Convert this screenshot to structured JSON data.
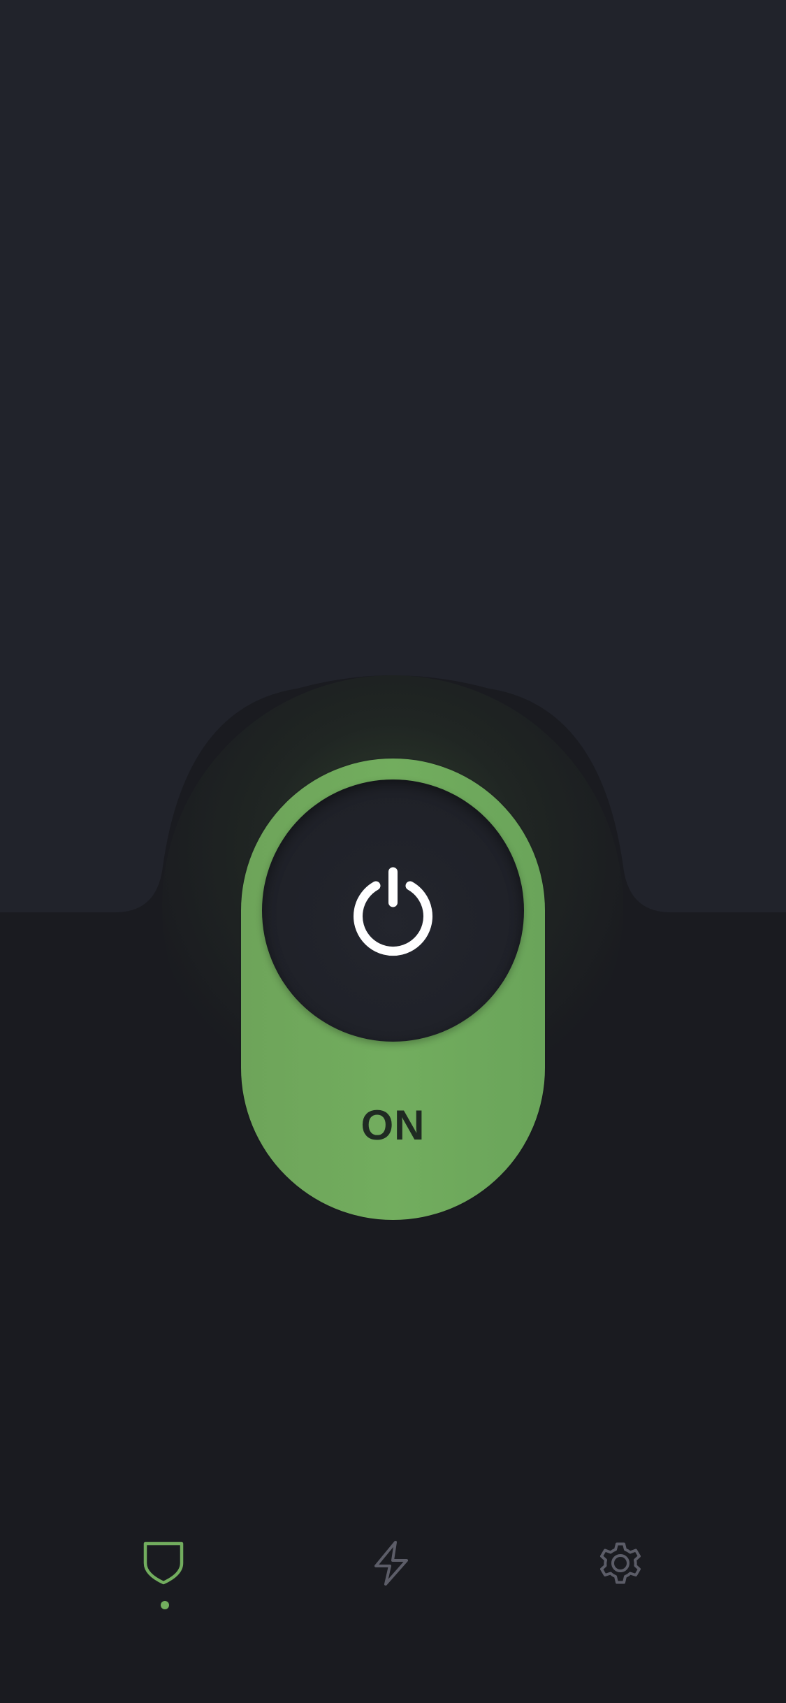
{
  "toggle": {
    "state_label": "ON",
    "state": "on"
  },
  "colors": {
    "background_dark": "#1a1b20",
    "panel": "#21232b",
    "accent_green": "#72ad5e",
    "knob": "#1f2128",
    "icon_white": "#ffffff",
    "icon_inactive": "#5c5d68",
    "label_dark": "#1f2a22"
  },
  "icons": {
    "power": "power-icon",
    "shield": "shield-icon",
    "bolt": "lightning-bolt-icon",
    "settings": "gear-icon"
  },
  "bottom_nav": {
    "items": [
      {
        "id": "protection",
        "icon": "shield-icon",
        "active": true
      },
      {
        "id": "speed",
        "icon": "lightning-bolt-icon",
        "active": false
      },
      {
        "id": "settings",
        "icon": "gear-icon",
        "active": false
      }
    ]
  }
}
